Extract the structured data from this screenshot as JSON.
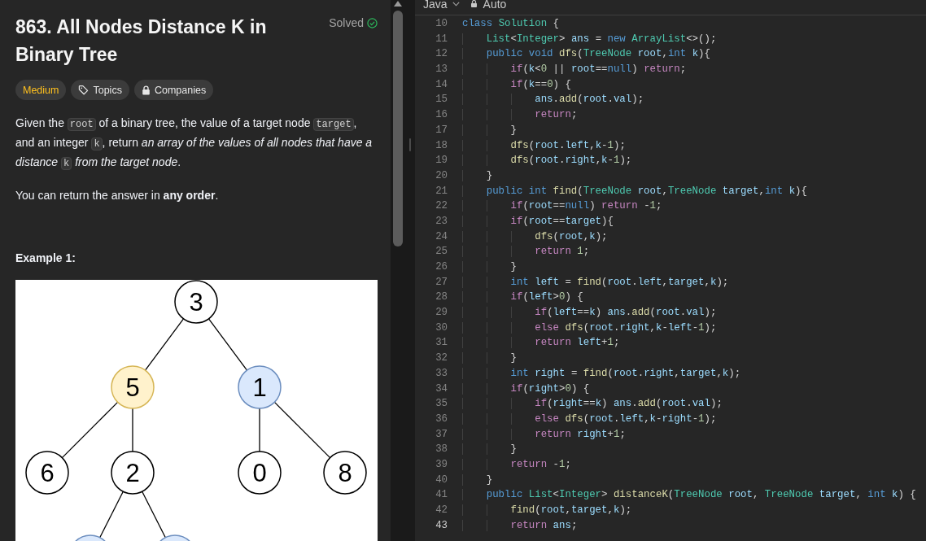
{
  "problem": {
    "title": "863. All Nodes Distance K in Binary Tree",
    "status": "Solved",
    "tags": [
      {
        "kind": "difficulty",
        "label": "Medium"
      },
      {
        "kind": "topics",
        "label": "Topics"
      },
      {
        "kind": "companies",
        "label": "Companies"
      }
    ],
    "description": [
      {
        "kind": "text",
        "text": "Given the "
      },
      {
        "kind": "code",
        "text": "root"
      },
      {
        "kind": "text",
        "text": " of a binary tree, the value of a target node "
      },
      {
        "kind": "code",
        "text": "target"
      },
      {
        "kind": "text",
        "text": ", and an integer "
      },
      {
        "kind": "code",
        "text": "k"
      },
      {
        "kind": "text",
        "text": ", return "
      },
      {
        "kind": "em",
        "text": "an array of the values of all nodes that have a distance "
      },
      {
        "kind": "code",
        "text": "k"
      },
      {
        "kind": "em",
        "text": " from the target node"
      },
      {
        "kind": "text",
        "text": "."
      }
    ],
    "note": "You can return the answer in **any order**.",
    "example": {
      "title": "Example 1:",
      "tree": {
        "value": "3",
        "color": "#ffffff",
        "children": [
          {
            "value": "5",
            "color": "#fff2cc",
            "children": [
              {
                "value": "6",
                "color": "#ffffff"
              },
              {
                "value": "2",
                "color": "#ffffff",
                "children": [
                  {
                    "color": "#dae8fc"
                  },
                  {
                    "color": "#dae8fc"
                  }
                ]
              }
            ]
          },
          {
            "value": "1",
            "color": "#dae8fc",
            "children": [
              {
                "value": "0",
                "color": "#ffffff"
              },
              {
                "value": "8",
                "color": "#ffffff"
              }
            ]
          }
        ]
      }
    }
  },
  "editor": {
    "language": "Java",
    "mode": "Auto",
    "lines": [
      {
        "number": "10",
        "code": "class Solution {",
        "current": false
      },
      {
        "number": "11",
        "code": "    List<Integer> ans = new ArrayList<>();",
        "current": false
      },
      {
        "number": "12",
        "code": "    public void dfs(TreeNode root,int k){",
        "current": false
      },
      {
        "number": "13",
        "code": "        if(k<0 || root==null) return;",
        "current": false
      },
      {
        "number": "14",
        "code": "        if(k==0) {",
        "current": false
      },
      {
        "number": "15",
        "code": "            ans.add(root.val);",
        "current": false
      },
      {
        "number": "16",
        "code": "            return;",
        "current": false
      },
      {
        "number": "17",
        "code": "        }",
        "current": false
      },
      {
        "number": "18",
        "code": "        dfs(root.left,k-1);",
        "current": false
      },
      {
        "number": "19",
        "code": "        dfs(root.right,k-1);",
        "current": false
      },
      {
        "number": "20",
        "code": "    }",
        "current": false
      },
      {
        "number": "21",
        "code": "    public int find(TreeNode root,TreeNode target,int k){",
        "current": false
      },
      {
        "number": "22",
        "code": "        if(root==null) return -1;",
        "current": false
      },
      {
        "number": "23",
        "code": "        if(root==target){",
        "current": false
      },
      {
        "number": "24",
        "code": "            dfs(root,k);",
        "current": false
      },
      {
        "number": "25",
        "code": "            return 1;",
        "current": false
      },
      {
        "number": "26",
        "code": "        }",
        "current": false
      },
      {
        "number": "27",
        "code": "        int left = find(root.left,target,k);",
        "current": false
      },
      {
        "number": "28",
        "code": "        if(left>0) {",
        "current": false
      },
      {
        "number": "29",
        "code": "            if(left==k) ans.add(root.val);",
        "current": false
      },
      {
        "number": "30",
        "code": "            else dfs(root.right,k-left-1);",
        "current": false
      },
      {
        "number": "31",
        "code": "            return left+1;",
        "current": false
      },
      {
        "number": "32",
        "code": "        }",
        "current": false
      },
      {
        "number": "33",
        "code": "        int right = find(root.right,target,k);",
        "current": false
      },
      {
        "number": "34",
        "code": "        if(right>0) {",
        "current": false
      },
      {
        "number": "35",
        "code": "            if(right==k) ans.add(root.val);",
        "current": false
      },
      {
        "number": "36",
        "code": "            else dfs(root.left,k-right-1);",
        "current": false
      },
      {
        "number": "37",
        "code": "            return right+1;",
        "current": false
      },
      {
        "number": "38",
        "code": "        }",
        "current": false
      },
      {
        "number": "39",
        "code": "        return -1;",
        "current": false
      },
      {
        "number": "40",
        "code": "    }",
        "current": false
      },
      {
        "number": "41",
        "code": "    public List<Integer> distanceK(TreeNode root, TreeNode target, int k) {",
        "current": false
      },
      {
        "number": "42",
        "code": "        find(root,target,k);",
        "current": false
      },
      {
        "number": "43",
        "code": "        return ans;",
        "current": true
      }
    ]
  }
}
